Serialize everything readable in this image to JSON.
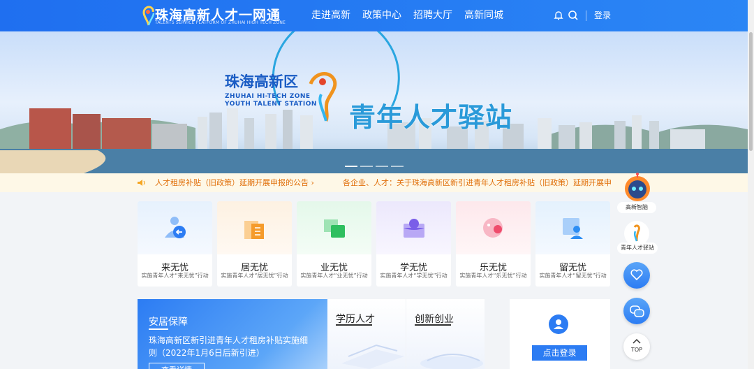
{
  "header": {
    "site_title": "珠海高新人才一网通",
    "site_subtitle": "TALENTS SERVICE PLATFORM OF ZHUHAI HIGH TECH ZONE",
    "nav": [
      "走进高新",
      "政策中心",
      "招聘大厅",
      "高新同城"
    ],
    "login": "登录",
    "icons": [
      "bell-icon",
      "search-icon"
    ]
  },
  "banner": {
    "title_cn": "珠海高新区",
    "title_en1": "ZHUHAI  HI-TECH  ZONE",
    "title_en2": "YOUTH TALENT STATION",
    "main_title": "青年人才驿站",
    "slide_count": 4,
    "active_slide": 1
  },
  "notices": [
    "人才租房补贴（旧政策）延期开展申报的公告 ›",
    "各企业、人才：关于珠海高新区新引进青年人才租房补贴（旧政策）延期开展申报的公告"
  ],
  "cards": [
    {
      "title": "来无忧",
      "sub": "实施青年人才“来无忧”行动",
      "color": "#2c7cf3",
      "bg": "#e6f1fd"
    },
    {
      "title": "居无忧",
      "sub": "实施青年人才“居无忧”行动",
      "color": "#f59b2b",
      "bg": "#fdf1e2"
    },
    {
      "title": "业无忧",
      "sub": "实施青年人才“业无忧”行动",
      "color": "#2fbf5f",
      "bg": "#e4f8ea"
    },
    {
      "title": "学无忧",
      "sub": "实施青年人才“学无忧”行动",
      "color": "#7a5ee8",
      "bg": "#ece8fc"
    },
    {
      "title": "乐无忧",
      "sub": "实施青年人才“乐无忧”行动",
      "color": "#ef4b6c",
      "bg": "#fde8ec"
    },
    {
      "title": "留无忧",
      "sub": "实施青年人才“留无忧”行动",
      "color": "#2c8df3",
      "bg": "#e4f1fd"
    }
  ],
  "panels": {
    "featured_title": "安居保障",
    "featured_text": "珠海高新区新引进青年人才租房补贴实施细则（2022年1月6日后新引进）",
    "featured_button": "查看详情",
    "tab1": "学历人才",
    "tab2": "创新创业",
    "login_button": "点击登录"
  },
  "side": {
    "robot_label": "高新智脑",
    "station_label": "青年人才驿站",
    "top_label": "TOP"
  },
  "colors": {
    "brand": "#2c7cf3",
    "notice_text": "#e06f0a",
    "notice_bg": "#fef8e7"
  }
}
